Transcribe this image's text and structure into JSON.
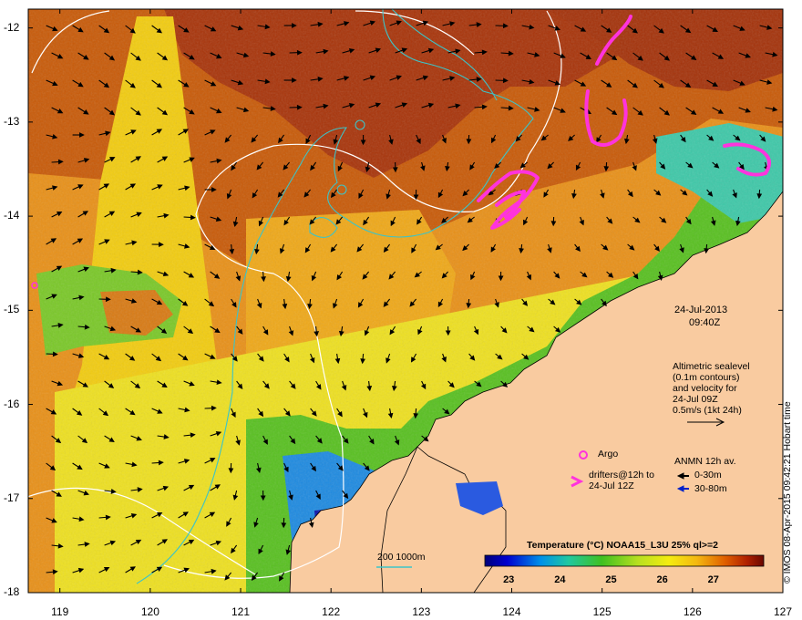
{
  "map": {
    "lon_ticks": [
      "119",
      "120",
      "121",
      "122",
      "123",
      "124",
      "125",
      "126",
      "127"
    ],
    "lat_ticks": [
      "-12",
      "-13",
      "-14",
      "-15",
      "-16",
      "-17",
      "-18"
    ],
    "date": "24-Jul-2013",
    "time": "09:40Z",
    "altimetry_text": [
      "Altimetric sealevel",
      "(0.1m contours)",
      "and velocity for",
      "24-Jul 09Z",
      "0.5m/s (1kt 24h)"
    ],
    "argo_label": "Argo",
    "drifters_text": [
      "drifters@12h to",
      "24-Jul 12Z"
    ],
    "anmn_title": "ANMN 12h av.",
    "anmn_depth1": "0-30m",
    "anmn_depth2": "30-80m",
    "isobath_label": "200  1000m",
    "colorbar_title": "Temperature (°C) NOAA15_L3U 25% ql>=2",
    "colorbar_ticks": [
      "23",
      "24",
      "25",
      "26",
      "27"
    ],
    "credit": "© IMOS 08-Apr-2015 09:42:21 Hobart time",
    "colors": {
      "land": "#f9cba0",
      "isobath": "#3cc4c8",
      "drifter": "#ff33dd",
      "anmn_deep": "#0020c8",
      "sst_cold": "#00007a",
      "sst_warm": "#8a0c00"
    }
  }
}
